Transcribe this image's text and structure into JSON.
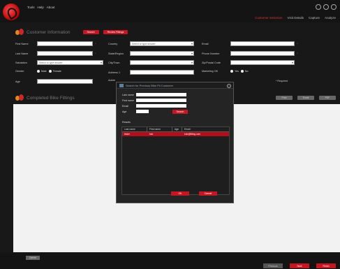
{
  "header": {
    "menu": [
      "Tools",
      "Help",
      "About"
    ],
    "tabs": [
      "Customer Selection",
      "Visit Details",
      "Capture",
      "Analyze"
    ]
  },
  "customer": {
    "title": "Customer Information",
    "search_label": "Search",
    "review_label": "Review Fittings",
    "first_name_label": "First Name",
    "last_name_label": "Last Name",
    "salutation_label": "Salutation",
    "salutation_value": "Select or type answer",
    "gender_label": "Gender",
    "gender_male": "Male",
    "gender_female": "Female",
    "age_label": "Age",
    "country_label": "Country",
    "country_value": "Select or type answer",
    "state_label": "State/Region",
    "city_label": "City/Town",
    "address1_label": "Address 1",
    "address2_label": "Addre",
    "email_label": "Email",
    "phone_label": "Phone Number",
    "zip_label": "Zip/Postal Code",
    "marketing_label": "Marketing OK",
    "marketing_yes": "Yes",
    "marketing_no": "No",
    "required_note": "* Required"
  },
  "fittings": {
    "title": "Completed Bike Fittings",
    "buttons": [
      "Print",
      "Email",
      "PDF"
    ],
    "delete_label": "Delete"
  },
  "footer": {
    "buttons": [
      "Previous",
      "Next",
      "Finish"
    ]
  },
  "modal": {
    "title": "Search for Previous Bike Fit Customer",
    "last_name_label": "Last name",
    "first_name_label": "First name",
    "email_label": "Email",
    "age_label": "Age",
    "search_label": "Search",
    "results_label": "Results",
    "columns": [
      "Last name",
      "First name",
      "Age",
      "Email"
    ],
    "rows": [
      [
        "tester",
        "bob",
        "",
        "bob@fitting.com"
      ]
    ],
    "ok_label": "OK",
    "cancel_label": "Cancel"
  },
  "colors": {
    "accent": "#c41623",
    "background": "#181818"
  }
}
